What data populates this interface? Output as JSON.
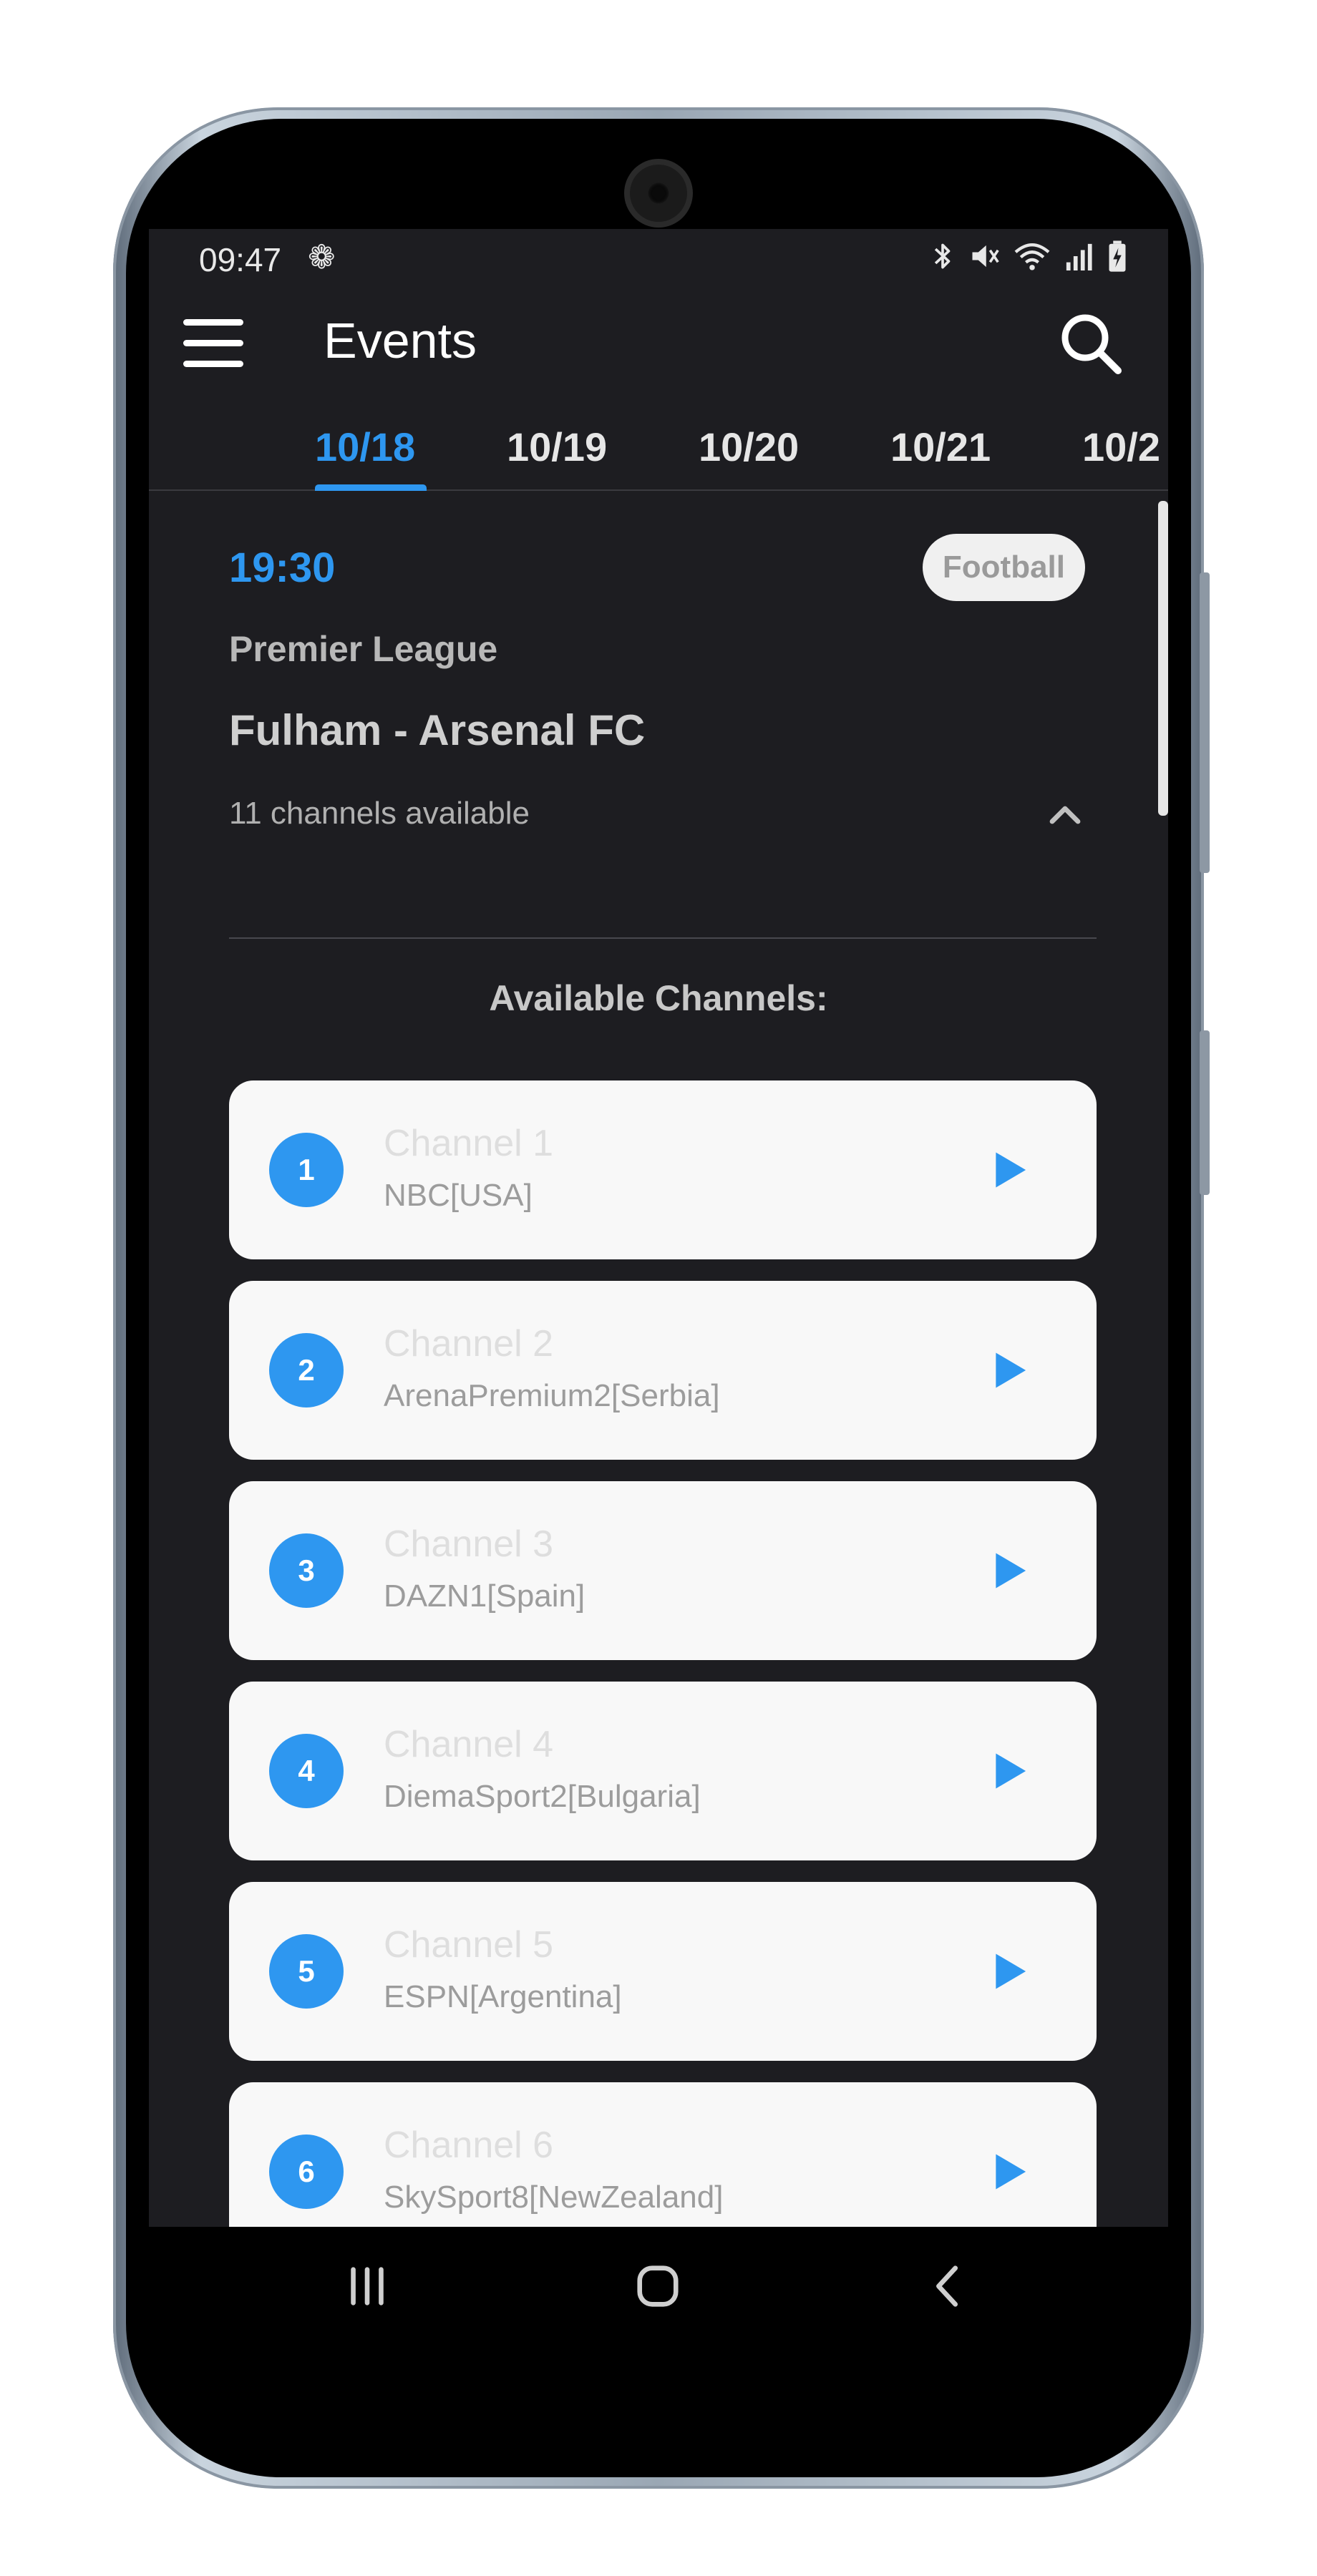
{
  "status_bar": {
    "time": "09:47",
    "gear_glyph": "❁",
    "icons_glyph": "✱ 🔇 ◠ ▮▮ ▮",
    "icons": [
      "bluetooth-icon",
      "mute-icon",
      "wifi-icon",
      "signal-icon",
      "battery-icon"
    ]
  },
  "app_bar": {
    "title": "Events"
  },
  "tabs": [
    {
      "label": "10/18",
      "active": true
    },
    {
      "label": "10/19",
      "active": false
    },
    {
      "label": "10/20",
      "active": false
    },
    {
      "label": "10/21",
      "active": false
    },
    {
      "label": "10/2",
      "active": false
    }
  ],
  "event": {
    "time": "19:30",
    "sport": "Football",
    "league": "Premier League",
    "match": "Fulham - Arsenal FC",
    "channels_count": "11 channels available"
  },
  "available_heading": "Available Channels:",
  "channels": [
    {
      "num": "1",
      "name": "Channel 1",
      "source": "NBC[USA]"
    },
    {
      "num": "2",
      "name": "Channel 2",
      "source": "ArenaPremium2[Serbia]"
    },
    {
      "num": "3",
      "name": "Channel 3",
      "source": "DAZN1[Spain]"
    },
    {
      "num": "4",
      "name": "Channel 4",
      "source": "DiemaSport2[Bulgaria]"
    },
    {
      "num": "5",
      "name": "Channel 5",
      "source": "ESPN[Argentina]"
    },
    {
      "num": "6",
      "name": "Channel 6",
      "source": "SkySport8[NewZealand]"
    }
  ],
  "colors": {
    "accent": "#2e97f0",
    "background": "#1d1d21",
    "card": "#f8f8f8"
  }
}
